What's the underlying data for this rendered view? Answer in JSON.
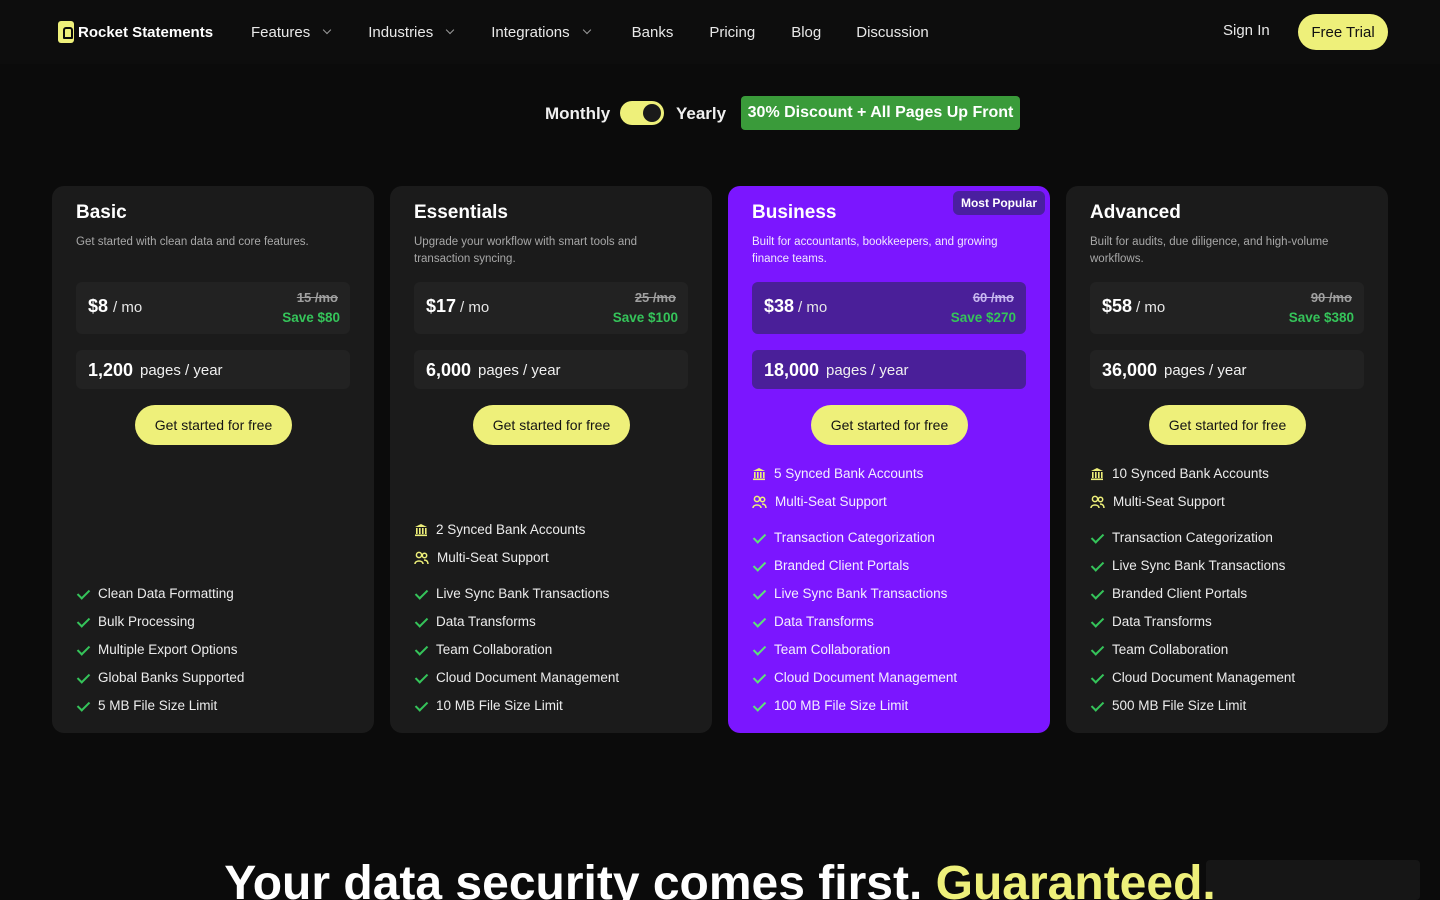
{
  "brand": {
    "name": "Rocket Statements",
    "accent": "#eef07a",
    "featured_bg": "#7b16ff",
    "save_color": "#35c45a"
  },
  "nav": {
    "items": [
      {
        "label": "Features",
        "dropdown": true
      },
      {
        "label": "Industries",
        "dropdown": true
      },
      {
        "label": "Integrations",
        "dropdown": true
      },
      {
        "label": "Banks",
        "dropdown": false
      },
      {
        "label": "Pricing",
        "dropdown": false
      },
      {
        "label": "Blog",
        "dropdown": false
      },
      {
        "label": "Discussion",
        "dropdown": false
      }
    ],
    "sign_in": "Sign In",
    "free_trial": "Free Trial"
  },
  "billing": {
    "monthly": "Monthly",
    "yearly": "Yearly",
    "yearly_selected": true,
    "discount": "30% Discount + All Pages Up Front"
  },
  "plans": [
    {
      "name": "Basic",
      "description": "Get started with clean data and core features.",
      "price": "$8",
      "per": "/ mo",
      "old_price": "15 /mo",
      "save": "Save $80",
      "pages": "1,200",
      "pages_unit": "pages / year",
      "cta": "Get started for free",
      "featured": false,
      "extras": [],
      "features": [
        "Clean Data Formatting",
        "Bulk Processing",
        "Multiple Export Options",
        "Global Banks Supported",
        "5 MB File Size Limit"
      ]
    },
    {
      "name": "Essentials",
      "description": "Upgrade your workflow with smart tools and transaction syncing.",
      "price": "$17",
      "per": "/ mo",
      "old_price": "25 /mo",
      "save": "Save $100",
      "pages": "6,000",
      "pages_unit": "pages / year",
      "cta": "Get started for free",
      "featured": false,
      "extras": [
        "2 Synced Bank Accounts",
        "Multi-Seat Support"
      ],
      "features": [
        "Live Sync Bank Transactions",
        "Data Transforms",
        "Team Collaboration",
        "Cloud Document Management",
        "10 MB File Size Limit"
      ]
    },
    {
      "name": "Business",
      "badge": "Most Popular",
      "description": "Built for accountants, bookkeepers, and growing finance teams.",
      "price": "$38",
      "per": "/ mo",
      "old_price": "60 /mo",
      "save": "Save $270",
      "pages": "18,000",
      "pages_unit": "pages / year",
      "cta": "Get started for free",
      "featured": true,
      "extras": [
        "5 Synced Bank Accounts",
        "Multi-Seat Support"
      ],
      "features": [
        "Transaction Categorization",
        "Branded Client Portals",
        "Live Sync Bank Transactions",
        "Data Transforms",
        "Team Collaboration",
        "Cloud Document Management",
        "100 MB File Size Limit"
      ]
    },
    {
      "name": "Advanced",
      "description": "Built for audits, due diligence, and high-volume workflows.",
      "price": "$58",
      "per": "/ mo",
      "old_price": "90 /mo",
      "save": "Save $380",
      "pages": "36,000",
      "pages_unit": "pages / year",
      "cta": "Get started for free",
      "featured": false,
      "extras": [
        "10 Synced Bank Accounts",
        "Multi-Seat Support"
      ],
      "features": [
        "Transaction Categorization",
        "Live Sync Bank Transactions",
        "Branded Client Portals",
        "Data Transforms",
        "Team Collaboration",
        "Cloud Document Management",
        "500 MB File Size Limit"
      ]
    }
  ],
  "headline": {
    "main": "Your data security comes first.",
    "highlight": "Guaranteed."
  }
}
